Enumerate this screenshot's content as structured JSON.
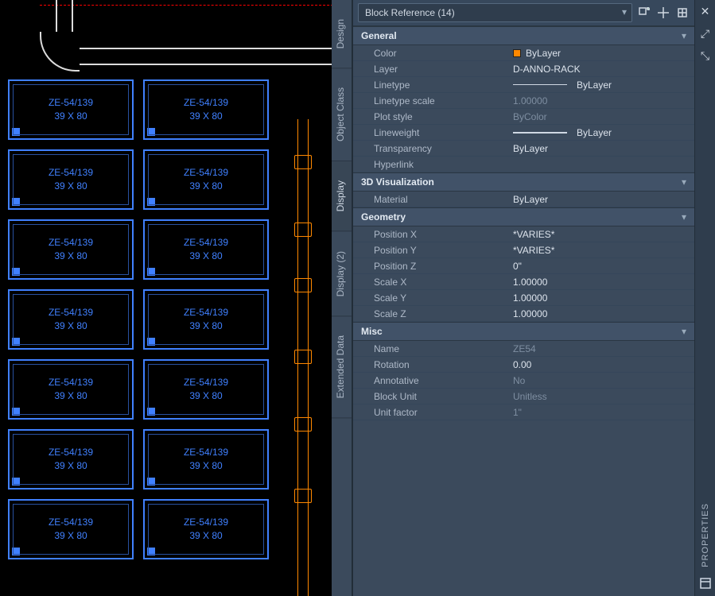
{
  "selection_label": "Block Reference (14)",
  "side_tabs": [
    "Design",
    "Object Class",
    "Display",
    "Display (2)",
    "Extended Data"
  ],
  "active_side_tab_index": 2,
  "right_strip_label": "PROPERTIES",
  "rack_block": {
    "code": "ZE-54/139",
    "size": "39 X 80",
    "count": 14
  },
  "sections": {
    "general": {
      "title": "General",
      "color_swatch": "#ff8800",
      "color": "ByLayer",
      "layer": "D-ANNO-RACK",
      "linetype": "ByLayer",
      "linetype_scale": "1.00000",
      "plot_style": "ByColor",
      "lineweight": "ByLayer",
      "transparency": "ByLayer",
      "hyperlink": ""
    },
    "vis3d": {
      "title": "3D Visualization",
      "material": "ByLayer"
    },
    "geometry": {
      "title": "Geometry",
      "position_x": "*VARIES*",
      "position_y": "*VARIES*",
      "position_z": "0\"",
      "scale_x": "1.00000",
      "scale_y": "1.00000",
      "scale_z": "1.00000"
    },
    "misc": {
      "title": "Misc",
      "name": "ZE54",
      "rotation": "0.00",
      "annotative": "No",
      "block_unit": "Unitless",
      "unit_factor": "1\""
    }
  },
  "labels": {
    "color": "Color",
    "layer": "Layer",
    "linetype": "Linetype",
    "linetype_scale": "Linetype scale",
    "plot_style": "Plot style",
    "lineweight": "Lineweight",
    "transparency": "Transparency",
    "hyperlink": "Hyperlink",
    "material": "Material",
    "position_x": "Position X",
    "position_y": "Position Y",
    "position_z": "Position Z",
    "scale_x": "Scale X",
    "scale_y": "Scale Y",
    "scale_z": "Scale Z",
    "name": "Name",
    "rotation": "Rotation",
    "annotative": "Annotative",
    "block_unit": "Block Unit",
    "unit_factor": "Unit factor"
  }
}
